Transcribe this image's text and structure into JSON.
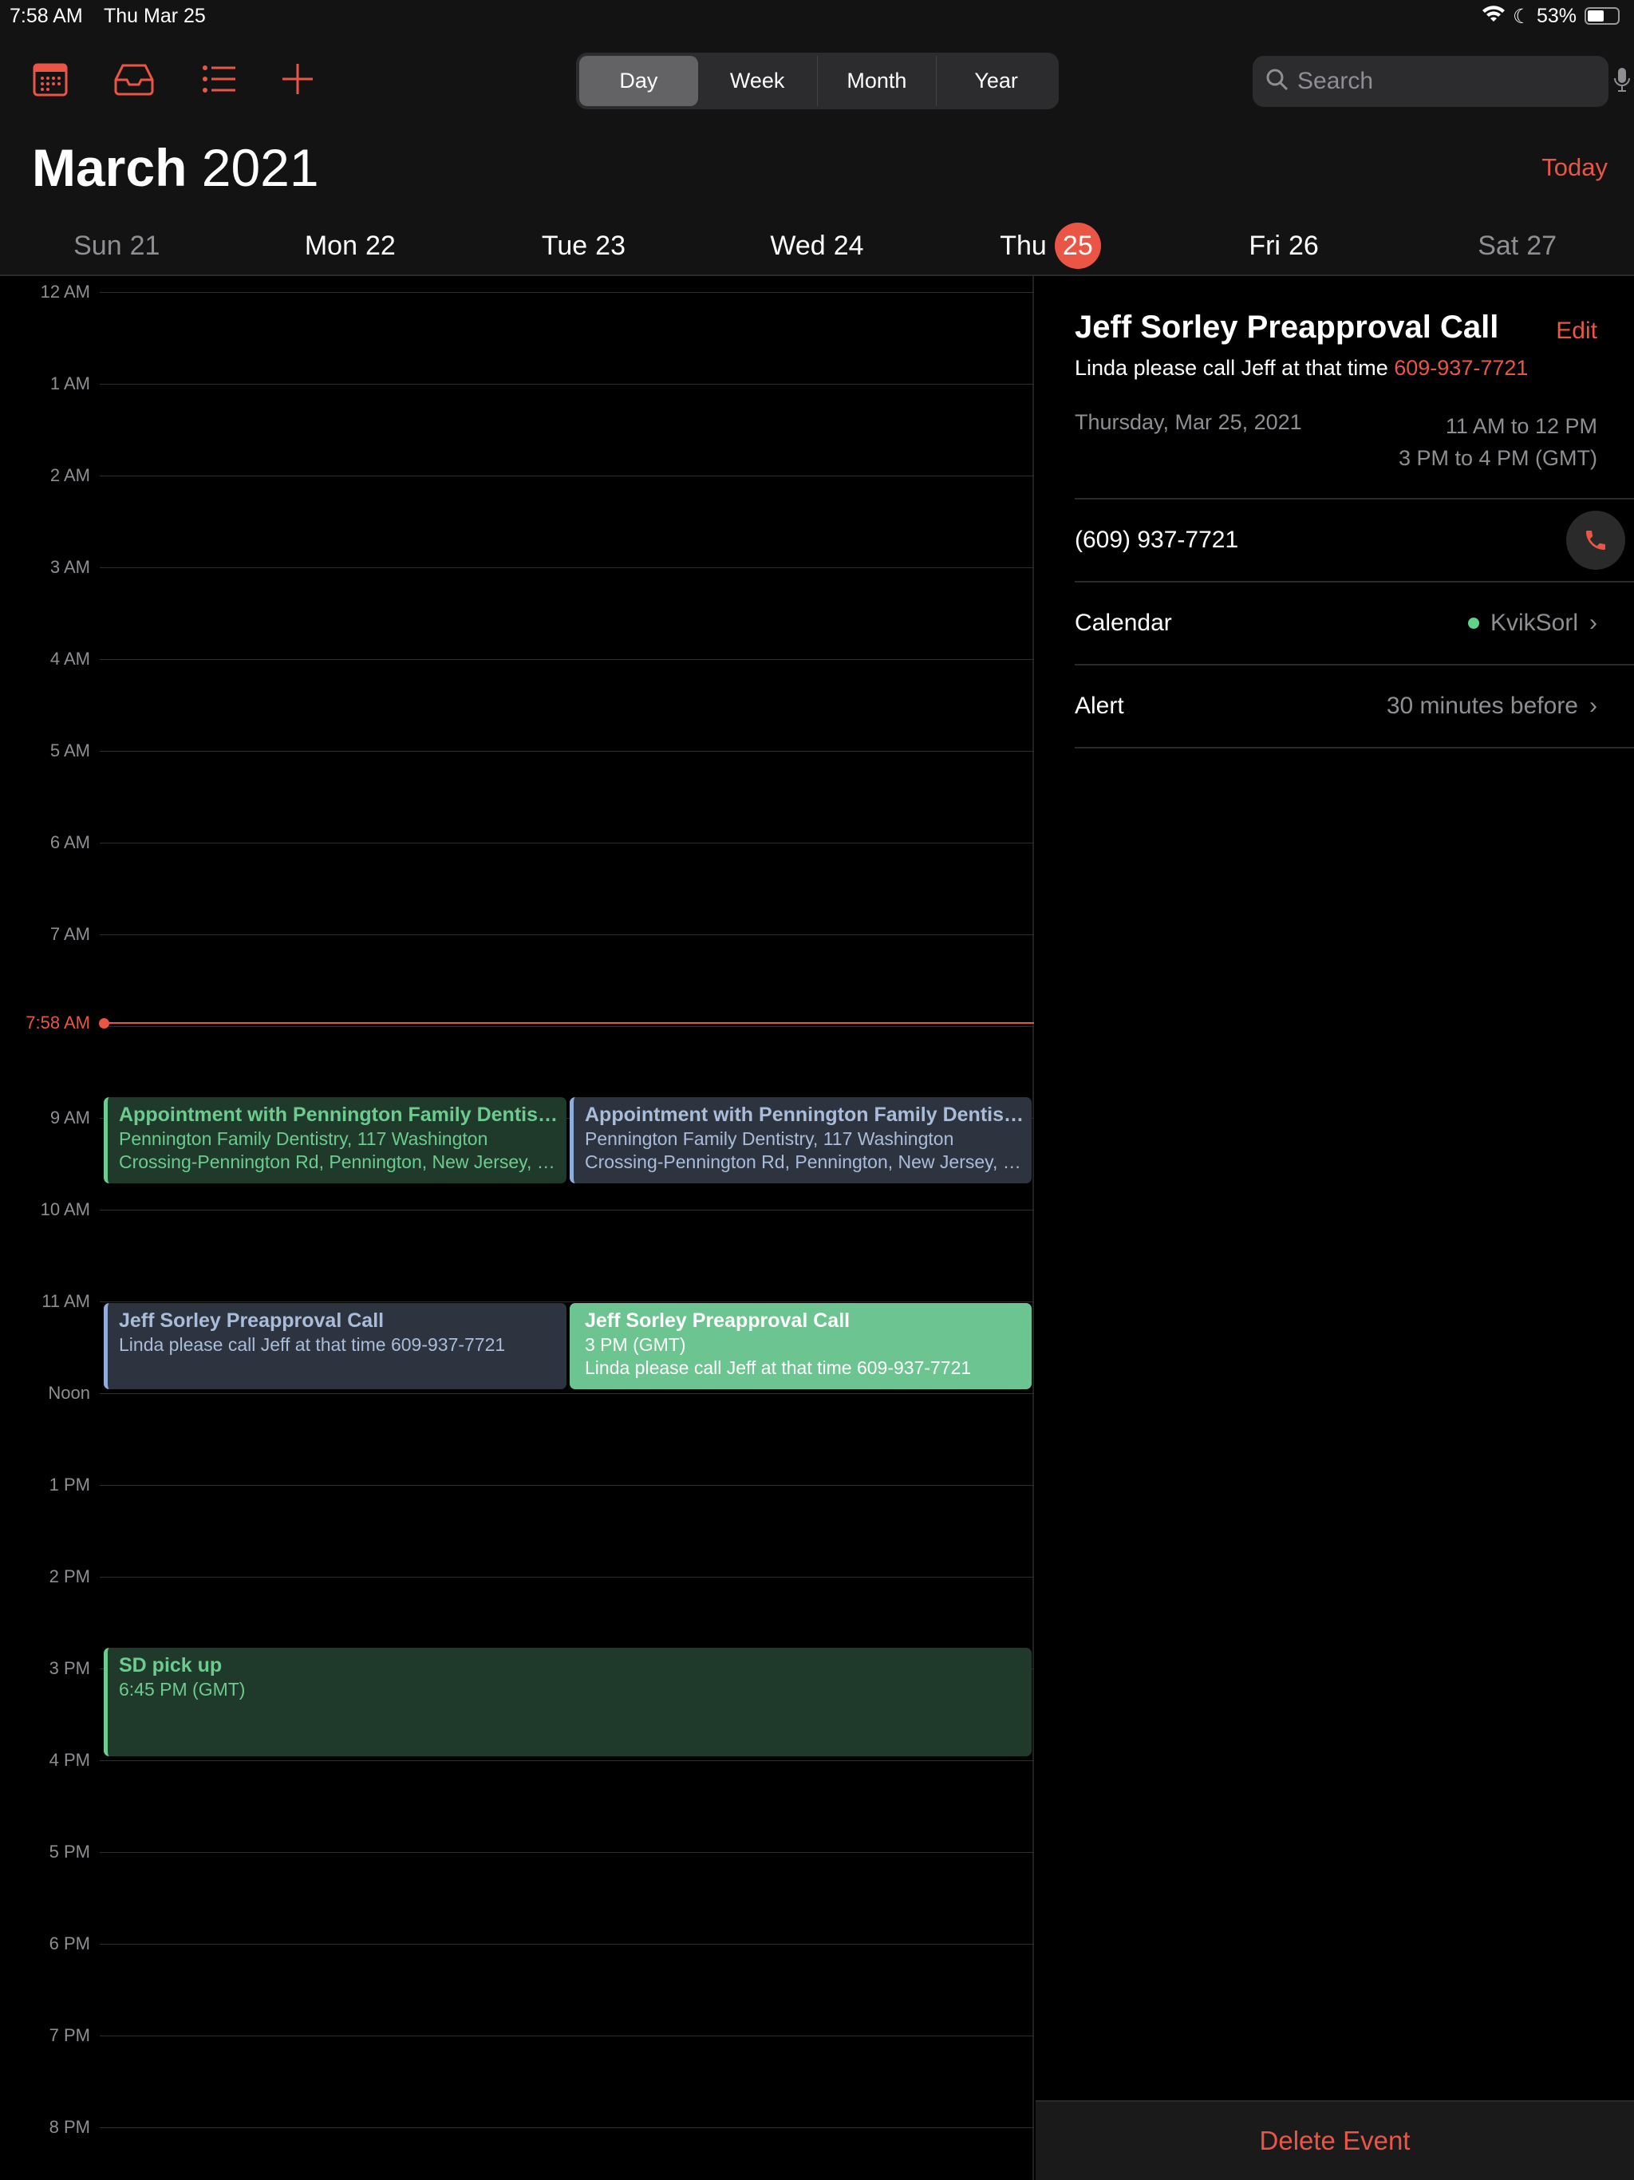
{
  "status": {
    "time": "7:58 AM",
    "date": "Thu Mar 25",
    "battery": "53%"
  },
  "toolbar": {
    "icons": [
      "calendars-icon",
      "inbox-icon",
      "list-icon",
      "add-icon"
    ],
    "views": [
      "Day",
      "Week",
      "Month",
      "Year"
    ],
    "selected": "Day",
    "search_placeholder": "Search"
  },
  "header": {
    "month": "March",
    "year": "2021",
    "today": "Today",
    "days": [
      {
        "label": "Sun",
        "num": "21"
      },
      {
        "label": "Mon",
        "num": "22"
      },
      {
        "label": "Tue",
        "num": "23"
      },
      {
        "label": "Wed",
        "num": "24"
      },
      {
        "label": "Thu",
        "num": "25",
        "today": true
      },
      {
        "label": "Fri",
        "num": "26"
      },
      {
        "label": "Sat",
        "num": "27"
      }
    ]
  },
  "grid": {
    "hours": [
      "12 AM",
      "1 AM",
      "2 AM",
      "3 AM",
      "4 AM",
      "5 AM",
      "6 AM",
      "7 AM",
      "",
      "9 AM",
      "10 AM",
      "11 AM",
      "Noon",
      "1 PM",
      "2 PM",
      "3 PM",
      "4 PM",
      "5 PM",
      "6 PM",
      "7 PM",
      "8 PM"
    ],
    "now_label": "7:58 AM",
    "now_hour": 7.967
  },
  "events": [
    {
      "title": "Appointment with Pennington Family Dentistry",
      "line1": "Pennington Family Dentistry, 117 Washington",
      "line2": "Crossing-Pennington Rd, Pennington, New Jersey, United States"
    },
    {
      "title": "Appointment with Pennington Family Dentistry",
      "line1": "Pennington Family Dentistry, 117 Washington",
      "line2": "Crossing-Pennington Rd, Pennington, New Jersey, United States"
    },
    {
      "title": "Jeff Sorley Preapproval Call",
      "line1": "Linda please call Jeff at that time 609-937-7721"
    },
    {
      "title": "Jeff Sorley Preapproval Call",
      "line1": "3 PM (GMT)",
      "line2": "Linda please call Jeff at that time 609-937-7721"
    },
    {
      "title": "SD pick up",
      "line1": "6:45 PM (GMT)"
    }
  ],
  "detail": {
    "title": "Jeff Sorley Preapproval Call",
    "edit": "Edit",
    "notes": "Linda please call Jeff at that time ",
    "phone_link": "609-937-7721",
    "date": "Thursday, Mar 25, 2021",
    "time": "11 AM to 12 PM",
    "time_gmt": "3 PM to 4 PM (GMT)",
    "phone": "(609) 937-7721",
    "calendar_label": "Calendar",
    "calendar_value": "KvikSorl",
    "calendar_color": "#5fd38a",
    "alert_label": "Alert",
    "alert_value": "30 minutes before",
    "delete": "Delete Event"
  },
  "colors": {
    "accent": "#eb5545"
  }
}
